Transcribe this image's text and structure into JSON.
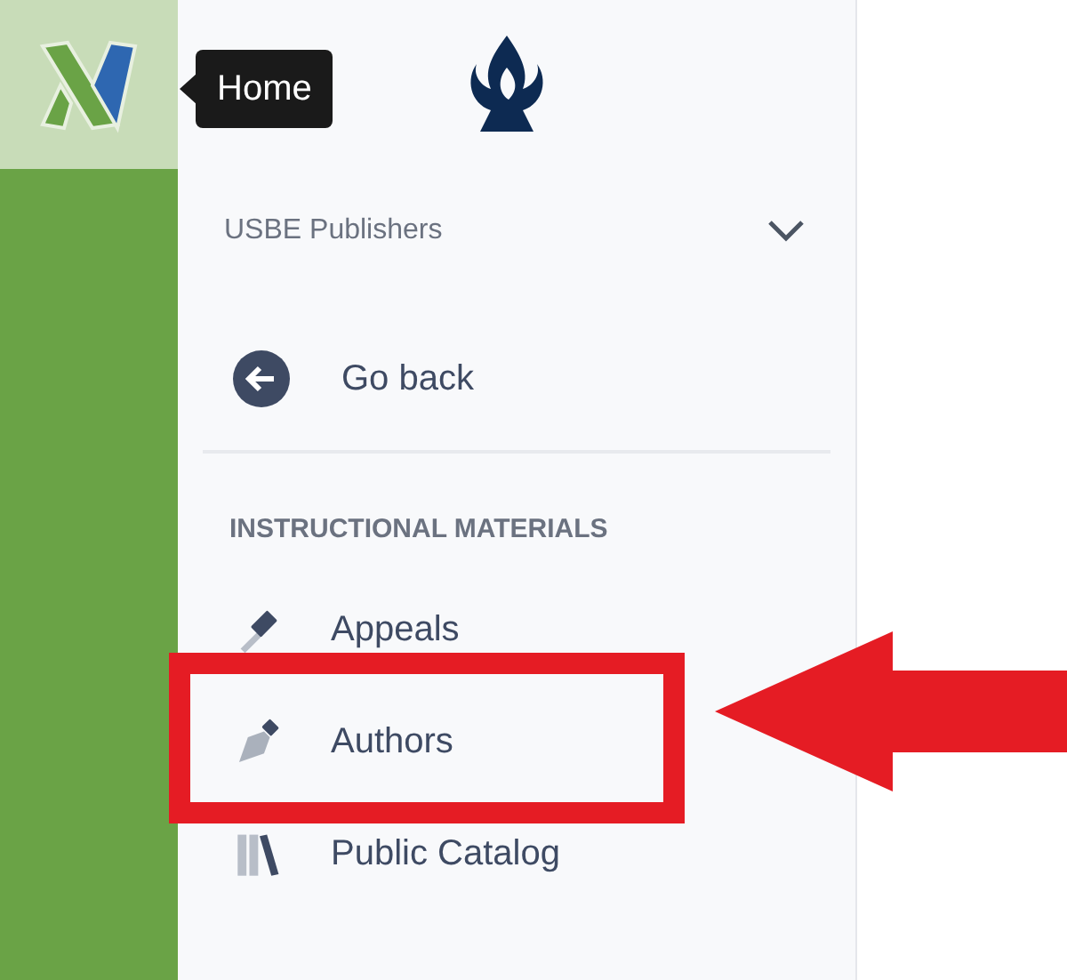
{
  "tooltip": {
    "text": "Home"
  },
  "org_selector": {
    "label": "USBE Publishers"
  },
  "back": {
    "label": "Go back"
  },
  "section": {
    "title": "INSTRUCTIONAL MATERIALS",
    "items": [
      {
        "kind": "gavel",
        "label": "Appeals"
      },
      {
        "kind": "pen",
        "label": "Authors"
      },
      {
        "kind": "books",
        "label": "Public Catalog"
      }
    ]
  }
}
